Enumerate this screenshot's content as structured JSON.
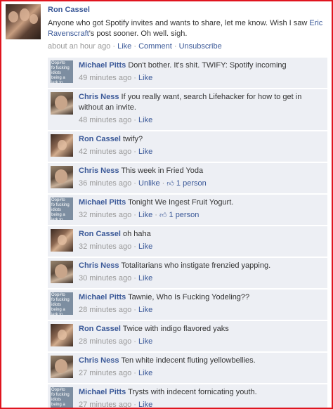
{
  "post": {
    "author": "Ron Cassel",
    "text_before": "Anyone who got Spotify invites and wants to share, let me know. Wish I saw ",
    "mention": "Eric Ravenscraft",
    "text_after": "'s post sooner. Oh well. sigh.",
    "time": "about an hour ago",
    "sep": "·",
    "actions": [
      "Like",
      "Comment",
      "Unsubscribe"
    ]
  },
  "comments": [
    {
      "author": "Michael Pitts",
      "text": "Don't bother. It's shit. TWIFY: Spotify incoming",
      "time": "49 minutes ago",
      "like_label": "Like",
      "likes": "",
      "avatar": "mp",
      "avatar_text": "Oop#to\nfo fucking\nidiots\nbeing a\njerk to\nall"
    },
    {
      "author": "Chris Ness",
      "text": "If you really want, search Lifehacker for how to get in without an invite.",
      "time": "48 minutes ago",
      "like_label": "Like",
      "likes": "",
      "avatar": "cn"
    },
    {
      "author": "Ron Cassel",
      "text": "twify?",
      "time": "42 minutes ago",
      "like_label": "Like",
      "likes": "",
      "avatar": "rc"
    },
    {
      "author": "Chris Ness",
      "text": "This week in Fried Yoda",
      "time": "36 minutes ago",
      "like_label": "Unlike",
      "likes": "1 person",
      "avatar": "cn"
    },
    {
      "author": "Michael Pitts",
      "text": "Tonight We Ingest Fruit Yogurt.",
      "time": "32 minutes ago",
      "like_label": "Like",
      "likes": "1 person",
      "avatar": "mp",
      "avatar_text": "Oop#to\nfo fucking\nidiots\nbeing a\njerk to\nall"
    },
    {
      "author": "Ron Cassel",
      "text": "oh haha",
      "time": "32 minutes ago",
      "like_label": "Like",
      "likes": "",
      "avatar": "rc"
    },
    {
      "author": "Chris Ness",
      "text": "Totalitarians who instigate frenzied yapping.",
      "time": "30 minutes ago",
      "like_label": "Like",
      "likes": "",
      "avatar": "cn"
    },
    {
      "author": "Michael Pitts",
      "text": "Tawnie, Who Is Fucking Yodeling??",
      "time": "28 minutes ago",
      "like_label": "Like",
      "likes": "",
      "avatar": "mp",
      "avatar_text": "Oop#to\nfo fucking\nidiots\nbeing a\njerk to\nall"
    },
    {
      "author": "Ron Cassel",
      "text": "Twice with indigo flavored yaks",
      "time": "28 minutes ago",
      "like_label": "Like",
      "likes": "",
      "avatar": "rc"
    },
    {
      "author": "Chris Ness",
      "text": "Ten white indecent fluting yellowbellies.",
      "time": "27 minutes ago",
      "like_label": "Like",
      "likes": "",
      "avatar": "cn"
    },
    {
      "author": "Michael Pitts",
      "text": "Trysts with indecent fornicating youth.",
      "time": "27 minutes ago",
      "like_label": "Like",
      "likes": "",
      "avatar": "mp",
      "avatar_text": "Oop#to\nfo fucking\nidiots\nbeing a\njerk to\nall"
    }
  ],
  "colors": {
    "link": "#3b5998",
    "meta": "#999999",
    "comment_bg": "#edeff4",
    "frame": "#e0141e"
  }
}
